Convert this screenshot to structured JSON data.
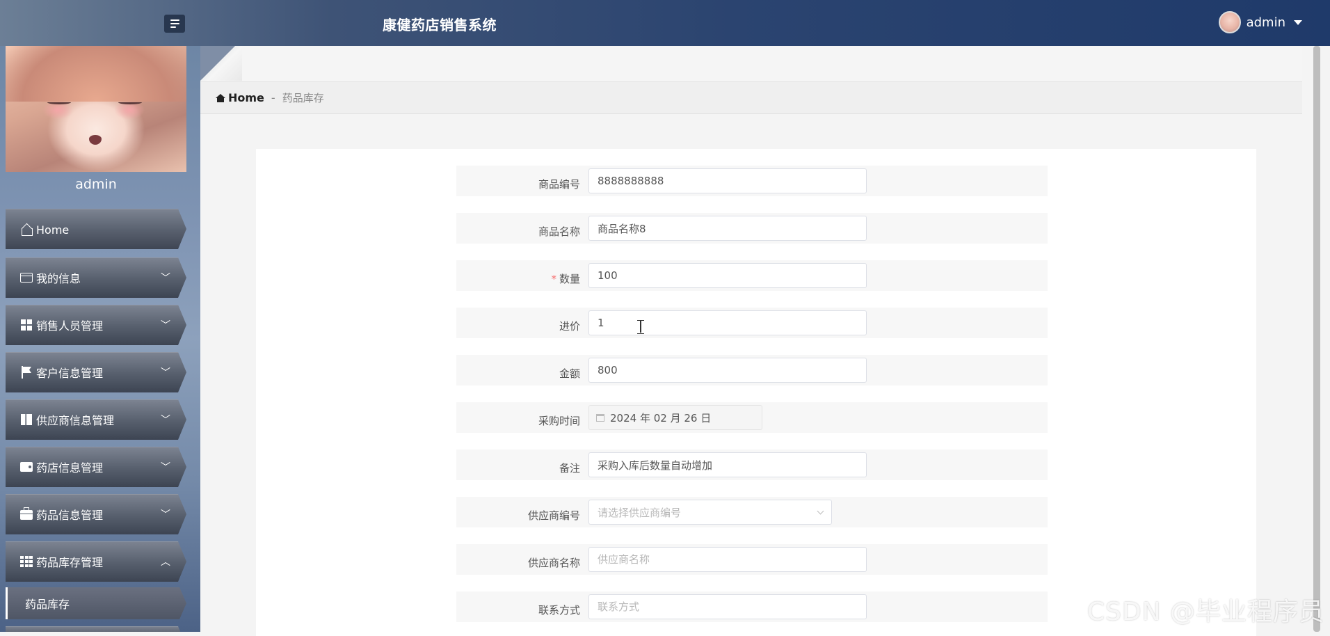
{
  "app": {
    "title": "康健药店销售系统",
    "user_name": "admin"
  },
  "sidebar": {
    "profile_name": "admin",
    "items": [
      {
        "label": "Home",
        "icon": "home-icon",
        "expanded": false
      },
      {
        "label": "我的信息",
        "icon": "id-card-icon",
        "expanded": false
      },
      {
        "label": "销售人员管理",
        "icon": "grid-icon",
        "expanded": false
      },
      {
        "label": "客户信息管理",
        "icon": "flag-icon",
        "expanded": false
      },
      {
        "label": "供应商信息管理",
        "icon": "book-icon",
        "expanded": false
      },
      {
        "label": "药店信息管理",
        "icon": "wallet-icon",
        "expanded": false
      },
      {
        "label": "药品信息管理",
        "icon": "briefcase-icon",
        "expanded": false
      },
      {
        "label": "药品库存管理",
        "icon": "grid-9-icon",
        "expanded": true
      }
    ],
    "sub_items": [
      {
        "label": "药品库存",
        "active": true
      }
    ]
  },
  "breadcrumb": {
    "home": "Home",
    "separator": "-",
    "current": "药品库存"
  },
  "form": {
    "fields": [
      {
        "label": "商品编号",
        "value": "8888888888",
        "placeholder": "",
        "required": false
      },
      {
        "label": "商品名称",
        "value": "商品名称8",
        "placeholder": "",
        "required": false
      },
      {
        "label": "数量",
        "value": "100",
        "placeholder": "",
        "required": true
      },
      {
        "label": "进价",
        "value": "1",
        "placeholder": "",
        "required": false
      },
      {
        "label": "金额",
        "value": "800",
        "placeholder": "",
        "required": false
      },
      {
        "label": "采购时间",
        "value": "2024 年 02 月 26 日",
        "placeholder": "",
        "required": false
      },
      {
        "label": "备注",
        "value": "采购入库后数量自动增加",
        "placeholder": "",
        "required": false
      },
      {
        "label": "供应商编号",
        "value": "",
        "placeholder": "请选择供应商编号",
        "required": false
      },
      {
        "label": "供应商名称",
        "value": "",
        "placeholder": "供应商名称",
        "required": false
      },
      {
        "label": "联系方式",
        "value": "",
        "placeholder": "联系方式",
        "required": false
      }
    ],
    "required_mark": "*"
  },
  "watermark": "CSDN @毕业程序员"
}
